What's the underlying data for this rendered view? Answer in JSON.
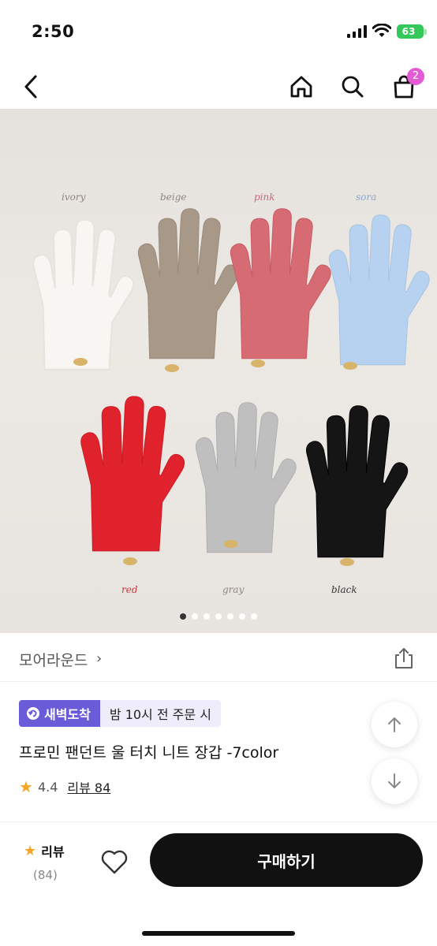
{
  "status": {
    "time": "2:50",
    "battery": "63"
  },
  "nav": {
    "cart_count": "2"
  },
  "product_image": {
    "color_labels": {
      "ivory": "ivory",
      "beige": "beige",
      "pink": "pink",
      "sora": "sora",
      "red": "red",
      "gray": "gray",
      "black": "black"
    },
    "glove_colors": {
      "ivory": "#f7f6f2",
      "beige": "#a89888",
      "pink": "#d76b74",
      "sora": "#b7d2f0",
      "red": "#e0222c",
      "gray": "#bfbfbf",
      "black": "#151515"
    },
    "slides_total": 7,
    "active_slide": 1
  },
  "brand": {
    "name": "모어라운드",
    "chevron": "›"
  },
  "delivery": {
    "badge": "새벽도착",
    "note": "밤 10시 전 주문 시"
  },
  "product": {
    "title": "프로민 팬던트 울 터치 니트 장갑 -7color",
    "rating": "4.4",
    "review_link": "리뷰 84"
  },
  "bottom_bar": {
    "review_label": "리뷰",
    "review_count": "(84)",
    "buy_label": "구매하기"
  },
  "colors": {
    "accent_purple": "#6a5cd8",
    "badge_pink": "#e35cd6",
    "star": "#f5a623",
    "buy_button": "#111111"
  }
}
